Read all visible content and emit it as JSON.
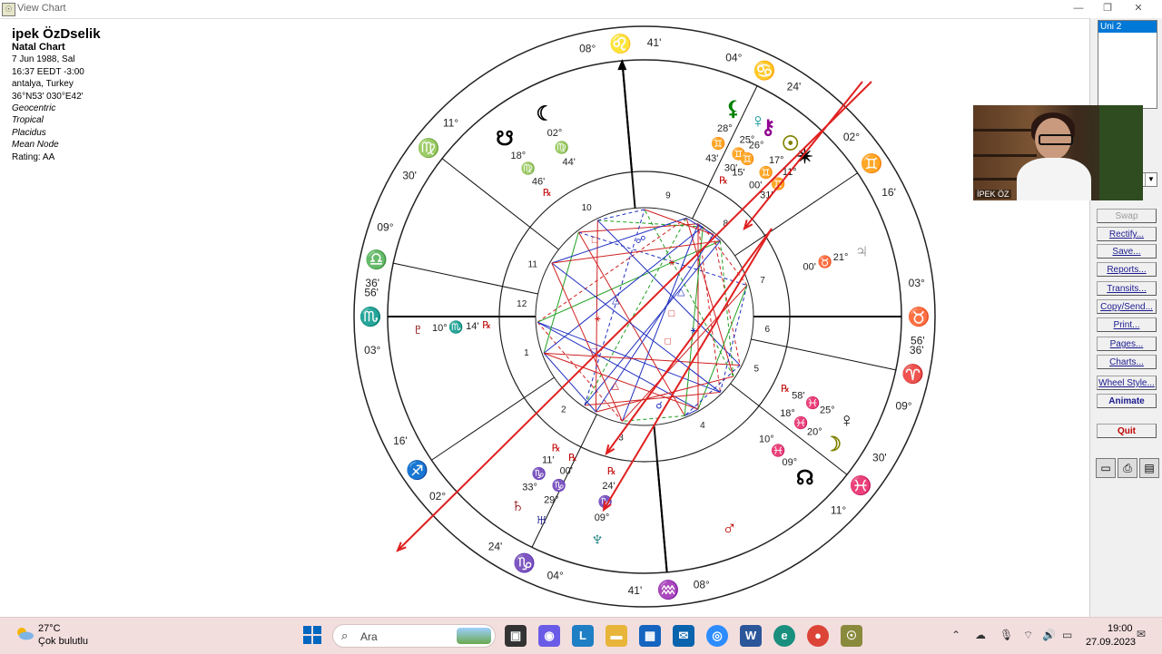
{
  "window": {
    "title": "View Chart",
    "app_icon": "solar-fire-icon"
  },
  "chart_info": {
    "name": "ipek ÖzDselik",
    "chart_type": "Natal Chart",
    "date": "7 Jun 1988, Sal",
    "time": "16:37  EEDT -3:00",
    "place": "antalya, Turkey",
    "coords": "36°N53' 030°E42'",
    "zodiac_ref": "Geocentric",
    "zodiac": "Tropical",
    "houses": "Placidus",
    "node": "Mean Node",
    "rating": "Rating: AA"
  },
  "wheel": {
    "house_numbers": [
      "1",
      "2",
      "3",
      "4",
      "5",
      "6",
      "7",
      "8",
      "9",
      "10",
      "11",
      "12"
    ],
    "cusp_labels": [
      {
        "deg": "08°",
        "sign": "♌",
        "min": "41'",
        "color": "#c00000"
      },
      {
        "deg": "04°",
        "sign": "♋",
        "min": "24'",
        "color": "#2020c0"
      },
      {
        "deg": "02°",
        "sign": "♊",
        "min": "16'",
        "color": "#20a0c0"
      },
      {
        "deg": "03°",
        "sign": "♉",
        "min": "36'",
        "color": "#20a020"
      },
      {
        "deg": "56'",
        "sign": "♈",
        "min": "09°",
        "color": "#c00000"
      },
      {
        "deg": "30'",
        "sign": "♓",
        "min": "11°",
        "color": "#2020c0"
      },
      {
        "deg": "08°",
        "sign": "♒",
        "min": "41'",
        "color": "#20a0c0"
      },
      {
        "deg": "04°",
        "sign": "♑",
        "min": "24'",
        "color": "#20a020"
      },
      {
        "deg": "02°",
        "sign": "♐",
        "min": "16'",
        "color": "#c00000"
      },
      {
        "deg": "03°",
        "sign": "♏",
        "min": "36'",
        "color": "#2020c0"
      },
      {
        "deg": "56'",
        "sign": "♎",
        "min": "09°",
        "color": "#20a0c0"
      },
      {
        "deg": "30'",
        "sign": "♍",
        "min": "11°",
        "color": "#20a020"
      }
    ],
    "planets": [
      {
        "glyph": "♇",
        "deg": "10°",
        "sign": "♏",
        "min": "14'",
        "retro": "℞",
        "color": "#8b0000"
      },
      {
        "glyph": "☋",
        "deg": "18°",
        "sign": "♍",
        "min": "46'",
        "retro": "℞",
        "color": "#000000"
      },
      {
        "glyph": "☾",
        "deg": "02°",
        "sign": "♍",
        "min": "44'",
        "retro": "",
        "color": "#000000"
      },
      {
        "glyph": "⚸",
        "deg": "28°",
        "sign": "♊",
        "min": "43'",
        "retro": "",
        "color": "#008000"
      },
      {
        "glyph": "♀",
        "deg": "25°",
        "sign": "♊",
        "min": "30'",
        "retro": "℞",
        "color": "#009090"
      },
      {
        "glyph": "⚷",
        "deg": "26°",
        "sign": "♊",
        "min": "15'",
        "retro": "",
        "color": "#900090"
      },
      {
        "glyph": "☉",
        "deg": "17°",
        "sign": "♊",
        "min": "00'",
        "retro": "",
        "color": "#808000"
      },
      {
        "glyph": "✴",
        "deg": "11°",
        "sign": "♊",
        "min": "31'",
        "retro": "",
        "color": "#000000"
      },
      {
        "glyph": "♃",
        "deg": "21°",
        "sign": "♉",
        "min": "00'",
        "retro": "",
        "color": "#808080"
      },
      {
        "glyph": "♀",
        "deg": "25°",
        "sign": "♓",
        "min": "58'",
        "retro": "℞",
        "color": "#000000"
      },
      {
        "glyph": "☽",
        "deg": "20°",
        "sign": "♓",
        "min": "18°",
        "retro": "",
        "color": "#808000"
      },
      {
        "glyph": "☊",
        "deg": "09°",
        "sign": "♓",
        "min": "10°",
        "retro": "",
        "color": "#000000"
      },
      {
        "glyph": "♂",
        "deg": "",
        "sign": "",
        "min": "",
        "retro": "",
        "color": "#c00000"
      },
      {
        "glyph": "♅",
        "deg": "29°",
        "sign": "♑",
        "min": "00'",
        "retro": "℞",
        "color": "#000080"
      },
      {
        "glyph": "♄",
        "deg": "33°",
        "sign": "♑",
        "min": "11'",
        "retro": "℞",
        "color": "#8b0000"
      },
      {
        "glyph": "♆",
        "deg": "09°",
        "sign": "♑",
        "min": "24'",
        "retro": "℞",
        "color": "#007070"
      }
    ]
  },
  "right_panel": {
    "list_selected": "Uni 2",
    "buttons": [
      {
        "label": "Swap",
        "state": "disabled"
      },
      {
        "label": "Rectify...",
        "state": "normal"
      },
      {
        "label": "Save...",
        "state": "normal"
      },
      {
        "label": "Reports...",
        "state": "normal"
      },
      {
        "label": "Transits...",
        "state": "normal"
      },
      {
        "label": "Copy/Send...",
        "state": "normal"
      },
      {
        "label": "Print...",
        "state": "normal"
      },
      {
        "label": "Pages...",
        "state": "normal"
      },
      {
        "label": "Charts...",
        "state": "normal"
      },
      {
        "label": "Wheel Style...",
        "state": "normal"
      },
      {
        "label": "Animate",
        "state": "bold"
      },
      {
        "label": "Quit",
        "state": "red"
      }
    ]
  },
  "webcam": {
    "participant": "İPEK ÖZ"
  },
  "taskbar": {
    "weather_temp": "27°C",
    "weather_desc": "Çok bulutlu",
    "search_placeholder": "Ara",
    "time": "19:00",
    "date": "27.09.2023"
  }
}
